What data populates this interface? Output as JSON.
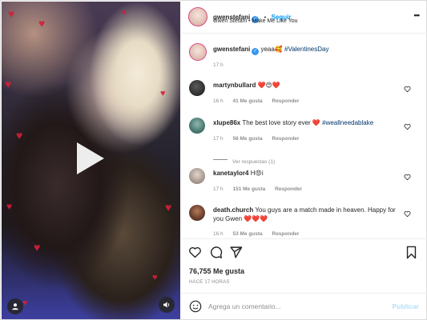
{
  "header": {
    "username": "gwenstefani",
    "separator": "•",
    "follow_label": "Seguir",
    "audio": "Gwen Stefani • Make Me Like You",
    "more_label": "•••"
  },
  "caption": {
    "username": "gwenstefani",
    "text": "yeaa🥰",
    "hashtag": "#ValentinesDay",
    "time": "17 h"
  },
  "comments": [
    {
      "username": "martynbullard",
      "text": "❤️😍❤️",
      "time": "16 h",
      "likes": "41 Me gusta",
      "reply": "Responder"
    },
    {
      "username": "xlupe86x",
      "text": "The best love story ever ❤️",
      "hashtag": "#weallneedablake",
      "time": "17 h",
      "likes": "56 Me gusta",
      "reply": "Responder",
      "view_replies": "Ver respuestas (1)"
    },
    {
      "username": "kanetaylor4",
      "text": "H😡i",
      "time": "17 h",
      "likes": "151 Me gusta",
      "reply": "Responder"
    },
    {
      "username": "death.church",
      "text": "You guys are a match made in heaven. Happy for you Gwen ❤️❤️❤️",
      "time": "16 h",
      "likes": "53 Me gusta",
      "reply": "Responder"
    }
  ],
  "post": {
    "likes": "76,755 Me gusta",
    "date": "HACE 17 HORAS"
  },
  "add_comment": {
    "placeholder": "Agrega un comentario...",
    "publish_label": "Publicar"
  },
  "colors": {
    "accent_blue": "#0095f6",
    "verified_blue": "#3897f0",
    "heart_red": "#d61f3a"
  },
  "icons": {
    "play": "play-icon",
    "user": "user-tag-icon",
    "volume": "volume-icon",
    "like": "heart-icon",
    "comment": "comment-icon",
    "share": "paper-plane-icon",
    "save": "bookmark-icon",
    "emoji": "emoji-icon"
  }
}
